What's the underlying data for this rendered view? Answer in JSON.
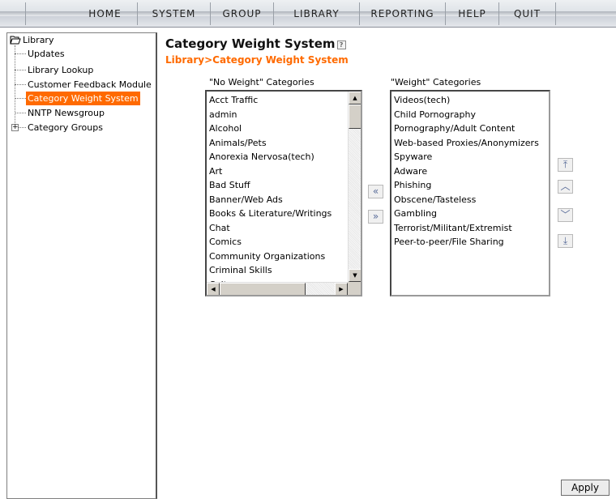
{
  "menu": {
    "items": [
      "HOME",
      "SYSTEM",
      "GROUP",
      "LIBRARY",
      "REPORTING",
      "HELP",
      "QUIT"
    ]
  },
  "tree": {
    "root": "Library",
    "items": [
      "Updates",
      "Library Lookup",
      "Customer Feedback Module",
      "Category Weight System",
      "NNTP Newsgroup",
      "Category Groups"
    ],
    "selected": "Category Weight System",
    "expand_symbol": "+"
  },
  "page": {
    "title": "Category Weight System",
    "help_symbol": "?",
    "breadcrumb": "Library>Category Weight System"
  },
  "no_weight": {
    "caption": "\"No Weight\" Categories",
    "items": [
      "Acct Traffic",
      "admin",
      "Alcohol",
      "Animals/Pets",
      "Anorexia Nervosa(tech)",
      "Art",
      "Bad Stuff",
      "Banner/Web Ads",
      "Books & Literature/Writings",
      "Chat",
      "Comics",
      "Community Organizations",
      "Criminal Skills",
      "Cults"
    ]
  },
  "weight": {
    "caption": "\"Weight\" Categories",
    "items": [
      "Videos(tech)",
      "Child Pornography",
      "Pornography/Adult Content",
      "Web-based Proxies/Anonymizers",
      "Spyware",
      "Adware",
      "Phishing",
      "Obscene/Tasteless",
      "Gambling",
      "Terrorist/Militant/Extremist",
      "Peer-to-peer/File Sharing"
    ]
  },
  "buttons": {
    "move_left": "«",
    "move_right": "»",
    "move_top": "⤒",
    "move_up": "︿",
    "move_down": "﹀",
    "move_bottom": "⤓",
    "apply": "Apply"
  },
  "icons": {
    "scroll_up": "▲",
    "scroll_down": "▼",
    "scroll_left": "◀",
    "scroll_right": "▶"
  },
  "colors": {
    "accent": "#ff6a00",
    "selected_bg": "#ff6a00",
    "button_arrow": "#5a6d9a"
  }
}
